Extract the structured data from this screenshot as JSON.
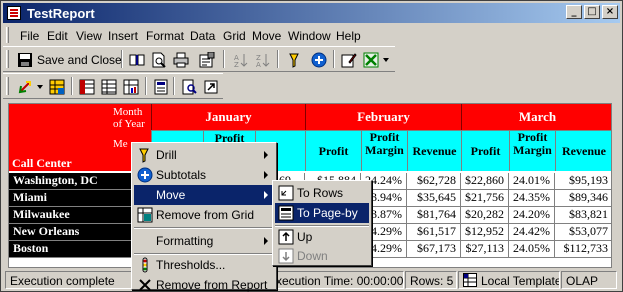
{
  "window": {
    "title": "TestReport"
  },
  "menubar": [
    "File",
    "Edit",
    "View",
    "Insert",
    "Format",
    "Data",
    "Grid",
    "Move",
    "Window",
    "Help"
  ],
  "toolbar1": {
    "save_close_label": "Save and Close"
  },
  "grid": {
    "corner_label": "Month of Year",
    "metrics_label": "Me",
    "row_attribute": "Call Center",
    "months": [
      "January",
      "February",
      "March"
    ],
    "metric_headers": {
      "january": [
        "Profit Margin",
        "nue"
      ],
      "february": [
        "Profit",
        "Profit Margin",
        "Revenue"
      ],
      "march": [
        "Profit",
        "Profit Margin",
        "Revenue"
      ]
    },
    "rows": [
      {
        "name": "Washington, DC",
        "jan_partial": "569",
        "jan_rev_partial": "$15,884",
        "feb_margin": "24.24%",
        "feb_revenue": "$62,728",
        "mar_profit": "$22,860",
        "mar_margin": "24.01%",
        "mar_revenue": "$95,193"
      },
      {
        "name": "Miami",
        "jan_partial": "",
        "jan_rev_partial": "",
        "feb_margin": "23.94%",
        "feb_revenue": "$35,645",
        "mar_profit": "$21,756",
        "mar_margin": "24.35%",
        "mar_revenue": "$89,346"
      },
      {
        "name": "Milwaukee",
        "jan_partial": "",
        "jan_rev_partial": "",
        "feb_margin": "23.87%",
        "feb_revenue": "$81,764",
        "mar_profit": "$20,282",
        "mar_margin": "24.20%",
        "mar_revenue": "$83,821"
      },
      {
        "name": "New Orleans",
        "jan_partial": "",
        "jan_rev_partial": "",
        "feb_margin": "24.29%",
        "feb_revenue": "$61,517",
        "mar_profit": "$12,952",
        "mar_margin": "24.42%",
        "mar_revenue": "$53,077"
      },
      {
        "name": "Boston",
        "jan_partial": "",
        "jan_rev_partial": "",
        "feb_margin": "24.29%",
        "feb_revenue": "$67,173",
        "mar_profit": "$27,113",
        "mar_margin": "24.05%",
        "mar_revenue": "$112,733"
      }
    ]
  },
  "context_menu": {
    "items": [
      {
        "label": "Drill",
        "submenu": true,
        "icon": "drill-icon"
      },
      {
        "label": "Subtotals",
        "submenu": true,
        "icon": "subtotals-icon"
      },
      {
        "label": "Move",
        "submenu": true,
        "icon": "",
        "highlighted": true
      },
      {
        "label": "Remove from Grid",
        "submenu": false,
        "icon": "remove-from-grid-icon"
      },
      {
        "label": "Formatting",
        "submenu": true,
        "icon": ""
      },
      {
        "label": "Thresholds...",
        "submenu": false,
        "icon": "thresholds-icon"
      },
      {
        "label": "Remove from Report",
        "submenu": false,
        "icon": "remove-icon"
      }
    ]
  },
  "move_submenu": {
    "items": [
      {
        "label": "To Rows",
        "icon": "to-rows-icon"
      },
      {
        "label": "To Page-by",
        "icon": "to-page-by-icon",
        "highlighted": true
      },
      {
        "label": "Up",
        "icon": "up-arrow-icon"
      },
      {
        "label": "Down",
        "icon": "down-arrow-icon",
        "disabled": true
      }
    ]
  },
  "statusbar": {
    "status": "Execution complete",
    "execution_time": "xecution Time: 00:00:00",
    "rows": "Rows: 5",
    "template": "Local Template",
    "mode": "OLAP"
  },
  "colors": {
    "header_red": "#ff0000",
    "metric_cyan": "#00ffff",
    "selection_blue": "#0a246a"
  }
}
